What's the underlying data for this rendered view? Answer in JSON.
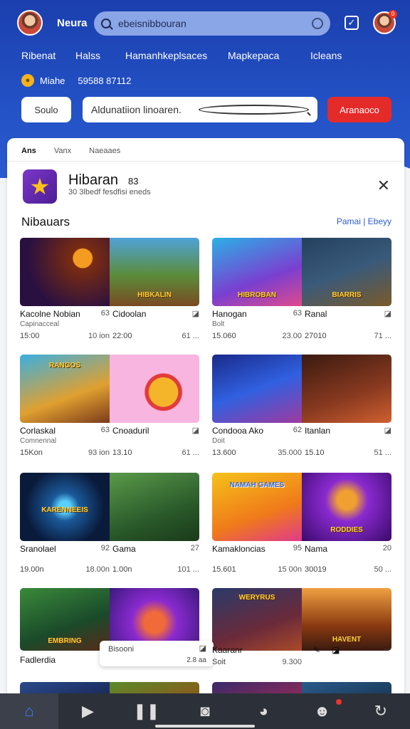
{
  "header": {
    "brand": "Neura",
    "search_value": "ebeisnibbouran",
    "check_icon": "check-square-icon",
    "profile_badge": "0"
  },
  "nav": [
    "Ribenat",
    "Halss",
    "Hamanhkeplsaces",
    "Mapkepaca",
    "Icleans"
  ],
  "coins": {
    "label": "Miahe",
    "amount": "59588 87112"
  },
  "actions": {
    "left_button": "Soulo",
    "search_placeholder": "Aldunatiion linoaren.",
    "right_button": "Aranaoco"
  },
  "panel": {
    "tabs": [
      "Ans",
      "Vanx",
      "Naeaaes"
    ],
    "app_title": "Hibaran",
    "app_title_suffix": "83",
    "app_subtitle": "30 3lbedf fesdfisi eneds",
    "section_title": "Nibauars",
    "section_links": "Pamai | Ebeyy"
  },
  "games": [
    {
      "left_title": "Kacolne Nobian",
      "left_num": "63",
      "left_sub": "Capinacceal",
      "left_a": "15:00",
      "left_b": "10 ion",
      "right_title": "Cidoolan",
      "right_a": "22:00",
      "right_b": "61 ...",
      "left_art": "HIBKALIN"
    },
    {
      "left_title": "Hanogan",
      "left_num": "63",
      "left_sub": "Bolt",
      "left_a": "15.060",
      "left_b": "23.00",
      "right_title": "Ranal",
      "right_a": "27010",
      "right_b": "71 ...",
      "left_art": "HIBROBAN",
      "right_art": "BIARRIS"
    },
    {
      "left_title": "Corlaskal",
      "left_num": "63",
      "left_sub": "Comnennal",
      "left_a": "15Kon",
      "left_b": "93 ion",
      "right_title": "Cnoaduril",
      "right_a": "13.10",
      "right_b": "61 ...",
      "left_art": "RANGOS"
    },
    {
      "left_title": "Condooa Ako",
      "left_num": "62",
      "left_sub": "Doit",
      "left_a": "13.600",
      "left_b": "35.000",
      "right_title": "Itanlan",
      "right_a": "15.10",
      "right_b": "51 ...",
      "left_art": "",
      "right_art": ""
    },
    {
      "left_title": "Sranolael",
      "left_num": "92",
      "left_a": "19.00n",
      "left_b": "18.00n",
      "right_title": "Gama",
      "right_num": "27",
      "right_a": "1.00n",
      "right_b": "101 ...",
      "left_art": "KARENNEEIS"
    },
    {
      "left_title": "Kamakloncias",
      "left_num": "95",
      "left_a": "15.601",
      "left_b": "15 00n",
      "right_title": "Nama",
      "right_num": "20",
      "right_a": "30019",
      "right_b": "50 ...",
      "left_art": "NAMAH GAMES",
      "right_art": "RODDIES"
    },
    {
      "left_title": "Fadlerdia",
      "float_title": "Bisooni",
      "float_meta": "2.8 aa",
      "left_art": "EMBRING"
    },
    {
      "left_title": "Kaaranr",
      "left_sub": "Soit",
      "left_meta": "9.300",
      "left_art": "WERYRUS",
      "right_art": "HAVENT"
    }
  ],
  "tabbar": [
    "home-icon",
    "play-icon",
    "pause-icon",
    "camera-icon",
    "compass-icon",
    "profile-icon",
    "refresh-icon"
  ],
  "colors": {
    "primary": "#1b3fae",
    "accent_red": "#e52a2a",
    "link": "#2c5bd0",
    "tabbar": "#2c3038"
  }
}
